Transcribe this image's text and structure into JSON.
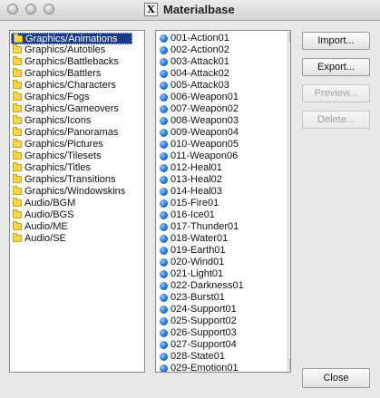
{
  "window": {
    "title": "Materialbase",
    "app_icon_glyph": "X"
  },
  "folders": {
    "selected_index": 0,
    "items": [
      "Graphics/Animations",
      "Graphics/Autotiles",
      "Graphics/Battlebacks",
      "Graphics/Battlers",
      "Graphics/Characters",
      "Graphics/Fogs",
      "Graphics/Gameovers",
      "Graphics/Icons",
      "Graphics/Panoramas",
      "Graphics/Pictures",
      "Graphics/Tilesets",
      "Graphics/Titles",
      "Graphics/Transitions",
      "Graphics/Windowskins",
      "Audio/BGM",
      "Audio/BGS",
      "Audio/ME",
      "Audio/SE"
    ]
  },
  "files": {
    "items": [
      "001-Action01",
      "002-Action02",
      "003-Attack01",
      "004-Attack02",
      "005-Attack03",
      "006-Weapon01",
      "007-Weapon02",
      "008-Weapon03",
      "009-Weapon04",
      "010-Weapon05",
      "011-Weapon06",
      "012-Heal01",
      "013-Heal02",
      "014-Heal03",
      "015-Fire01",
      "016-Ice01",
      "017-Thunder01",
      "018-Water01",
      "019-Earth01",
      "020-Wind01",
      "021-Light01",
      "022-Darkness01",
      "023-Burst01",
      "024-Support01",
      "025-Support02",
      "026-Support03",
      "027-Support04",
      "028-State01",
      "029-Emotion01"
    ]
  },
  "buttons": {
    "import": "Import...",
    "export": "Export...",
    "preview": "Preview...",
    "delete": "Delete...",
    "close": "Close"
  },
  "colors": {
    "selection": "#1c3a8a",
    "file_dot": "#1a6fd8",
    "folder": "#f7d64c"
  }
}
